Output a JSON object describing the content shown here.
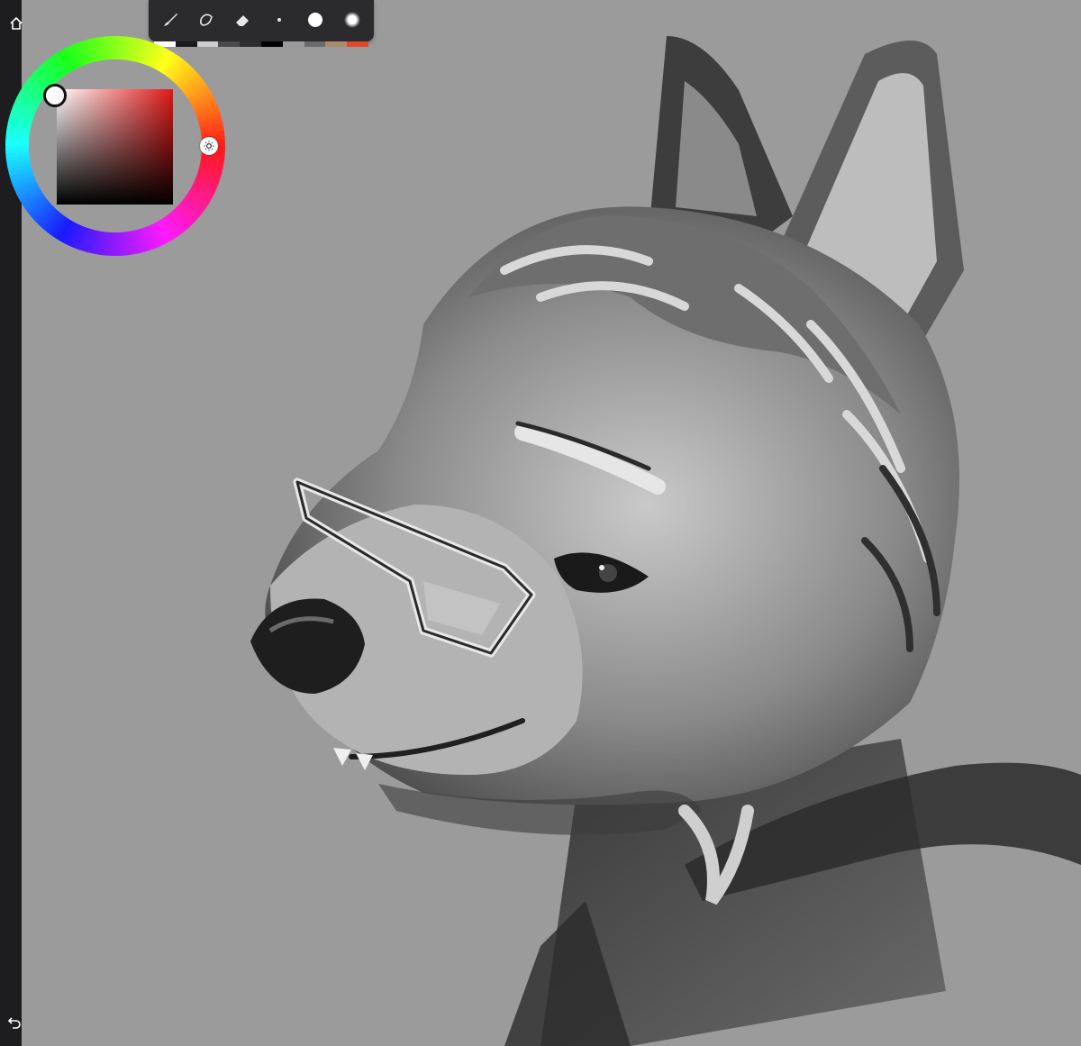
{
  "app": {
    "background_color": "#9b9b9b",
    "sidebar_color": "#1d1d1f"
  },
  "sidebar": {
    "home_icon": "home-icon",
    "undo_icon": "undo-icon"
  },
  "toolbar": {
    "tools": [
      {
        "name": "brush-tool",
        "icon": "brush-icon"
      },
      {
        "name": "smudge-tool",
        "icon": "smudge-icon"
      },
      {
        "name": "eraser-tool",
        "icon": "eraser-icon"
      },
      {
        "name": "small-brush-size",
        "icon": "dot-small-icon"
      },
      {
        "name": "large-brush-size",
        "icon": "dot-large-icon"
      },
      {
        "name": "soft-brush-preset",
        "icon": "soft-dot-icon"
      }
    ],
    "recent_colors": [
      "#ffffff",
      "#1a1a1a",
      "#cfcfcf",
      "#4a4a4a",
      "#2e2e2e",
      "#000000",
      "#9a9a9a",
      "#6b6b6b",
      "#a98d6a",
      "#e2452a"
    ]
  },
  "color_picker": {
    "selected_hue_color": "#e01818",
    "current_color": "#ffffff",
    "brightness_icon": "sun-icon"
  }
}
